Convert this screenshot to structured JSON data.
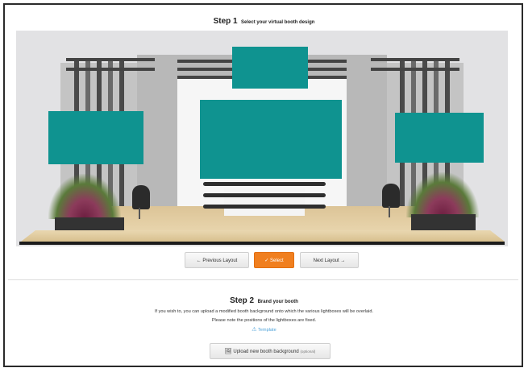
{
  "step1": {
    "number_label": "Step 1",
    "subtitle": "Select your virtual booth design"
  },
  "buttons": {
    "previous": "Previous Layout",
    "previous_icon": "←",
    "select": "Select",
    "select_icon": "✓",
    "next": "Next Layout",
    "next_icon": "→"
  },
  "step2": {
    "number_label": "Step 2",
    "subtitle": "Brand your booth",
    "description_line1": "If you wish to, you can upload a modified booth background onto which the various lightboxes will be overlaid.",
    "description_line2": "Please note the positions of the lightboxes are fixed.",
    "template_link": "Template",
    "template_icon": "warning-triangle-icon",
    "upload_button": "Upload new booth background",
    "upload_hint": "(optional)",
    "upload_icon": "image-icon"
  },
  "colors": {
    "lightbox": "#0f9390",
    "select_button": "#f07f1f",
    "link": "#4aa0d8"
  }
}
